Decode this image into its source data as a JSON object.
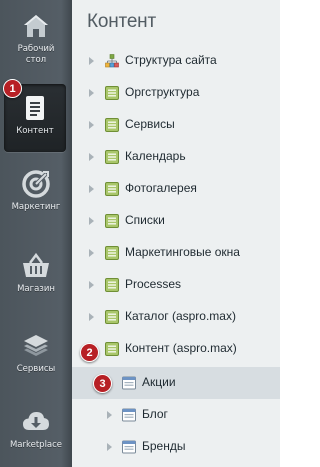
{
  "sidebar": {
    "items": [
      {
        "label": "Рабочий стол",
        "icon": "home-icon",
        "active": false
      },
      {
        "label": "Контент",
        "icon": "document-icon",
        "active": true
      },
      {
        "label": "Маркетинг",
        "icon": "target-icon",
        "active": false
      },
      {
        "label": "Магазин",
        "icon": "basket-icon",
        "active": false
      },
      {
        "label": "Сервисы",
        "icon": "layers-icon",
        "active": false
      },
      {
        "label": "Marketplace",
        "icon": "cloud-download-icon",
        "active": false
      }
    ]
  },
  "panel": {
    "title": "Контент",
    "tree": [
      {
        "label": "Структура сайта",
        "icon": "site-structure-icon"
      },
      {
        "label": "Оргструктура",
        "icon": "green-list-icon"
      },
      {
        "label": "Сервисы",
        "icon": "green-list-icon"
      },
      {
        "label": "Календарь",
        "icon": "green-list-icon"
      },
      {
        "label": "Фотогалерея",
        "icon": "green-list-icon"
      },
      {
        "label": "Списки",
        "icon": "green-list-icon"
      },
      {
        "label": "Маркетинговые окна",
        "icon": "green-list-icon"
      },
      {
        "label": "Processes",
        "icon": "green-list-icon"
      },
      {
        "label": "Каталог (aspro.max)",
        "icon": "green-list-icon"
      },
      {
        "label": "Контент (aspro.max)",
        "icon": "green-list-icon",
        "expanded": true
      },
      {
        "label": "Акции",
        "icon": "window-icon",
        "selected": true
      },
      {
        "label": "Блог",
        "icon": "window-icon"
      },
      {
        "label": "Бренды",
        "icon": "window-icon"
      }
    ]
  },
  "badges": [
    "1",
    "2",
    "3"
  ],
  "colors": {
    "sidebar_bg": "#555e66",
    "panel_bg": "#edf0f1",
    "selected_row": "#d7dde1",
    "badge": "#b72025",
    "tree_icon_green": "#8fb14a"
  }
}
